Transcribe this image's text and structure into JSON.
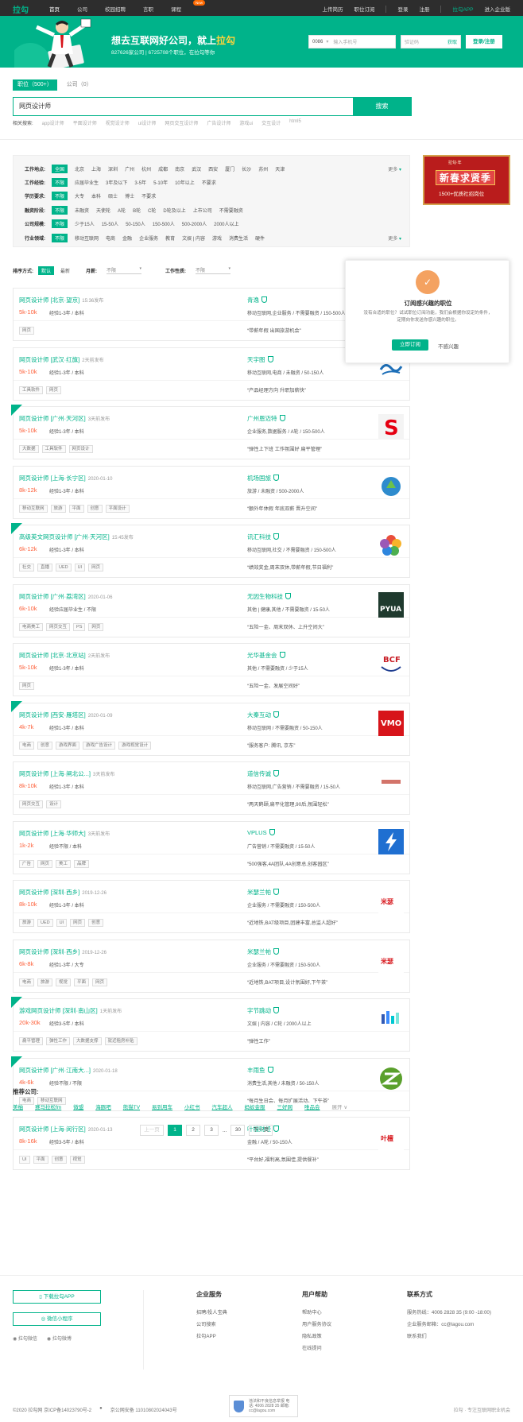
{
  "topbar": {
    "logo": "拉勾",
    "nav": [
      "首页",
      "公司",
      "校园招聘",
      "言职",
      "课程"
    ],
    "new_badge": "New",
    "right": [
      "上传简历",
      "职位订阅",
      "登录",
      "注册",
      "拉勾APP",
      "进入企业版"
    ]
  },
  "banner": {
    "slogan_a": "想去互联网好公司，就上",
    "slogan_b": "拉勾",
    "stat": "827626家公司 | 6725708个职位，在拉勾等你",
    "code": "0086",
    "phone_ph": "输入手机号",
    "sms_ph": "验证码",
    "get": "获取",
    "btn": "登录/注册"
  },
  "tabs": {
    "job": "职位（500+）",
    "company": "公司（0）"
  },
  "search": {
    "query": "网页设计师",
    "button": "搜索"
  },
  "related": {
    "label": "相关搜索:",
    "items": [
      "app设计师",
      "平面设计师",
      "视觉设计师",
      "ui设计师",
      "网页交互设计师",
      "广告设计师",
      "游戏ui",
      "交互设计",
      "html5"
    ]
  },
  "filters": [
    {
      "label": "工作地点:",
      "opts": [
        "全国",
        "北京",
        "上海",
        "深圳",
        "广州",
        "杭州",
        "成都",
        "南京",
        "武汉",
        "西安",
        "厦门",
        "长沙",
        "苏州",
        "天津"
      ],
      "on": 0,
      "more": "更多"
    },
    {
      "label": "工作经验:",
      "opts": [
        "不限",
        "应届毕业生",
        "3年及以下",
        "3-5年",
        "5-10年",
        "10年以上",
        "不要求"
      ],
      "on": 0,
      "more": ""
    },
    {
      "label": "学历要求:",
      "opts": [
        "不限",
        "大专",
        "本科",
        "硕士",
        "博士",
        "不要求"
      ],
      "on": 0,
      "more": ""
    },
    {
      "label": "融资阶段:",
      "opts": [
        "不限",
        "未融资",
        "天使轮",
        "A轮",
        "B轮",
        "C轮",
        "D轮及以上",
        "上市公司",
        "不需要融资"
      ],
      "on": 0,
      "more": ""
    },
    {
      "label": "公司规模:",
      "opts": [
        "不限",
        "少于15人",
        "15-50人",
        "50-150人",
        "150-500人",
        "500-2000人",
        "2000人以上"
      ],
      "on": 0,
      "more": ""
    },
    {
      "label": "行业领域:",
      "opts": [
        "不限",
        "移动互联网",
        "电商",
        "金融",
        "企业服务",
        "教育",
        "文娱 | 内容",
        "游戏",
        "消费生活",
        "硬件"
      ],
      "on": 0,
      "more": "更多"
    }
  ],
  "sort": {
    "label": "排序方式:",
    "default": "默认",
    "latest": "最新",
    "salary_label": "月薪:",
    "salary": "不限",
    "nature_label": "工作性质:",
    "nature": "不限"
  },
  "ad": {
    "top": "拉勾·年",
    "main": "新春求贤季",
    "sub": "1500+优质社招岗位"
  },
  "popup": {
    "title": "订阅感兴趣的职位",
    "desc": "没有合适的职位？试试职位订阅功能，我们会根据你设定的条件，定期向你发送你感兴趣的职位。",
    "btn": "立即订阅",
    "no": "不感兴趣"
  },
  "jobs": [
    {
      "title": "网页设计师 [北京·望京]",
      "time": "15:36发布",
      "salary": "5k-10k",
      "req": "经验1-3年 / 本科",
      "company": "青逸",
      "industry": "移动互联网,企业服务 / 不需要融资 / 150-500人",
      "tags": [
        "网页"
      ],
      "adv": "“带薪年假 出国旅游机会”",
      "urgent": false,
      "logo": "none",
      "logo_color": "#ffffff"
    },
    {
      "title": "网页设计师 [武汉·红旗]",
      "time": "2天前发布",
      "salary": "5k-10k",
      "req": "经验1-3年 / 本科",
      "company": "天宇图",
      "industry": "移动互联网,电商 / 未融资 / 50-150人",
      "tags": [
        "工具软件",
        "网页"
      ],
      "adv": "“产品经理方向 升职加薪快”",
      "urgent": false,
      "logo": "wave",
      "logo_color": "#1d6fb8"
    },
    {
      "title": "网页设计师 [广州·天河区]",
      "time": "3天前发布",
      "salary": "5k-10k",
      "req": "经验1-3年 / 本科",
      "company": "广州恩迈特",
      "industry": "企业服务,数据服务 / A轮 / 150-500人",
      "tags": [
        "大数据",
        "工具软件",
        "网页设计"
      ],
      "adv": "“弹性上下班 工作氛围好 扁平管理”",
      "urgent": true,
      "logo": "S",
      "logo_color": "#e60012"
    },
    {
      "title": "网页设计师 [上海·长宁区]",
      "time": "2020-01-10",
      "salary": "8k-12k",
      "req": "经验1-3年 / 本科",
      "company": "机场国旅",
      "industry": "旅游 / 未融资 / 500-2000人",
      "tags": [
        "移动互联网",
        "旅游",
        "平面",
        "创意",
        "平面设计"
      ],
      "adv": "“额外年休假 年底双薪 晋升空间”",
      "urgent": false,
      "logo": "drop",
      "logo_color": "#2e8bcd"
    },
    {
      "title": "高级英文网页设计师 [广州·天河区]",
      "time": "15:45发布",
      "salary": "6k-12k",
      "req": "经验1-3年 / 本科",
      "company": "讯汇科技",
      "industry": "移动互联网,社交 / 不需要融资 / 150-500人",
      "tags": [
        "社交",
        "直播",
        "UED",
        "UI",
        "网页"
      ],
      "adv": "“绩效奖金,周末双休,带薪年假,节日福利”",
      "urgent": true,
      "logo": "flower",
      "logo_color": "#e94e3b"
    },
    {
      "title": "网页设计师 [广州·荔湾区]",
      "time": "2020-01-06",
      "salary": "6k-10k",
      "req": "经验应届毕业生 / 不限",
      "company": "无因生物科技",
      "industry": "其他 | 健康,其他 / 不需要融资 / 15-50人",
      "tags": [
        "电商美工",
        "网页交互",
        "PS",
        "网页"
      ],
      "adv": "“五险一金、周末双休、上升空间大”",
      "urgent": false,
      "logo": "PYUA",
      "logo_color": "#1f3a2e"
    },
    {
      "title": "网页设计师 [北京·北京站]",
      "time": "2天前发布",
      "salary": "5k-10k",
      "req": "经验1-3年 / 本科",
      "company": "光华基金会",
      "industry": "其他 / 不需要融资 / 少于15人",
      "tags": [
        "网页"
      ],
      "adv": "“五险一金、发展空间好”",
      "urgent": false,
      "logo": "BCF",
      "logo_color": "#c81d25"
    },
    {
      "title": "网页设计师 [西安·雁塔区]",
      "time": "2020-01-09",
      "salary": "4k-7k",
      "req": "经验1-3年 / 本科",
      "company": "大秦互动",
      "industry": "移动互联网 / 不需要融资 / 50-150人",
      "tags": [
        "电商",
        "创意",
        "游戏界面",
        "游戏广告设计",
        "游戏视觉设计"
      ],
      "adv": "“服务客户: 腾讯, 京东”",
      "urgent": true,
      "logo": "VMO",
      "logo_color": "#d7141a"
    },
    {
      "title": "网页设计师 [上海·闸北公...]",
      "time": "3天前发布",
      "salary": "8k-10k",
      "req": "经验1-3年 / 本科",
      "company": "道信传诚",
      "industry": "移动互联网,广告营销 / 不需要融资 / 15-50人",
      "tags": [
        "网页交互",
        "设计"
      ],
      "adv": "“两天鹤颐,扁平化管理,90后,氛围轻松”",
      "urgent": false,
      "logo": "text",
      "logo_color": "#c0392b"
    },
    {
      "title": "网页设计师 [上海·华师大]",
      "time": "3天前发布",
      "salary": "1k-2k",
      "req": "经验不限 / 本科",
      "company": "VPLUS",
      "industry": "广告营销 / 不需要融资 / 15-50人",
      "tags": [
        "广告",
        "网页",
        "美工",
        "品牌"
      ],
      "adv": "“500强客,4A团队,4A创意总,创客园区”",
      "urgent": false,
      "logo": "bolt",
      "logo_color": "#1f6fd1"
    },
    {
      "title": "网页设计师 [深圳·西乡]",
      "time": "2019-12-26",
      "salary": "8k-10k",
      "req": "经验1-3年 / 本科",
      "company": "米瑟兰帕",
      "industry": "企业服务 / 不需要融资 / 150-500人",
      "tags": [
        "旅游",
        "UED",
        "UI",
        "网页",
        "创意"
      ],
      "adv": "“近地铁,BAT级项目,团建丰富,总监人超好”",
      "urgent": false,
      "logo": "米瑟兰帕",
      "logo_color": "#d7141a"
    },
    {
      "title": "网页设计师 [深圳·西乡]",
      "time": "2019-12-26",
      "salary": "6k-8k",
      "req": "经验1-3年 / 大专",
      "company": "米瑟兰帕",
      "industry": "企业服务 / 不需要融资 / 150-500人",
      "tags": [
        "电商",
        "旅游",
        "视觉",
        "平面",
        "网页"
      ],
      "adv": "“近地铁,BAT项目,设计氛围好,下午茶”",
      "urgent": false,
      "logo": "米瑟兰帕",
      "logo_color": "#d7141a"
    },
    {
      "title": "游戏网页设计师 [深圳·南山区]",
      "time": "1天前发布",
      "salary": "20k-30k",
      "req": "经验3-5年 / 本科",
      "company": "字节跳动",
      "industry": "文娱 | 内容 / C轮 / 2000人以上",
      "tags": [
        "扁平管理",
        "弹性工作",
        "大数据支撑",
        "就近租房补贴"
      ],
      "adv": "“弹性工作”",
      "urgent": true,
      "logo": "bytedance",
      "logo_color": "#325ab4"
    },
    {
      "title": "网页设计师 [广州·江南大...]",
      "time": "2020-01-18",
      "salary": "4k-6k",
      "req": "经验不限 / 不限",
      "company": "丰雨鱼",
      "industry": "消费生活,其他 / 未融资 / 50-150人",
      "tags": [
        "电商",
        "移动互联网"
      ],
      "adv": "“每月生日会、每月扩展活动、下午茶”",
      "urgent": true,
      "logo": "Z",
      "logo_color": "#5aa02c"
    },
    {
      "title": "网页设计师 [上海·闵行区]",
      "time": "2020-01-13",
      "salary": "8k-16k",
      "req": "经验3-5年 / 本科",
      "company": "叶檀财经",
      "industry": "金融 / A轮 / 50-150人",
      "tags": [
        "UI",
        "平面",
        "创意",
        "视觉"
      ],
      "adv": "“平台好,福利高,氛围佳,提供餐补”",
      "urgent": false,
      "logo": "叶檀财经",
      "logo_color": "#d7141a"
    }
  ],
  "recommend": {
    "label": "推荐公司:",
    "items": [
      "美柚",
      "赛马拉松fm",
      "微盟",
      "海豚吧",
      "熊猫TV",
      "易到用车",
      "小红书",
      "汽车超人",
      "蚂蚁金服",
      "三好网",
      "唯品会"
    ],
    "more": "展开"
  },
  "pager": {
    "prev": "上一页",
    "pages": [
      "1",
      "2",
      "3"
    ],
    "dots": "...",
    "last": "30",
    "next": "下一页"
  },
  "footer": {
    "app_btn": "下载拉勾APP",
    "mini_btn": "微信小程序",
    "wechat": "拉勾微信",
    "weibo": "拉勾微博",
    "col1": {
      "h": "企业服务",
      "items": [
        "招聘/投人宝典",
        "公司搜索",
        "拉勾APP"
      ]
    },
    "col2": {
      "h": "用户帮助",
      "items": [
        "帮助中心",
        "用户服务协议",
        "隐私政策",
        "在线提问"
      ]
    },
    "col3": {
      "h": "联系方式",
      "items": [
        "服务热线：4006 2828 35 (9:00 -18:00)",
        "企业服务邮箱：cc@lagou.com",
        "联系我们"
      ]
    },
    "copyright": "©2020 拉勾网 京ICP备14023790号-2",
    "police": "京公网安备 11010802024043号",
    "cert": "违法和不良信息举报 电话: 4006 2828 35 邮箱: cc@lagou.com",
    "slogan": "拉勾 · 专注互联网职业机会"
  }
}
